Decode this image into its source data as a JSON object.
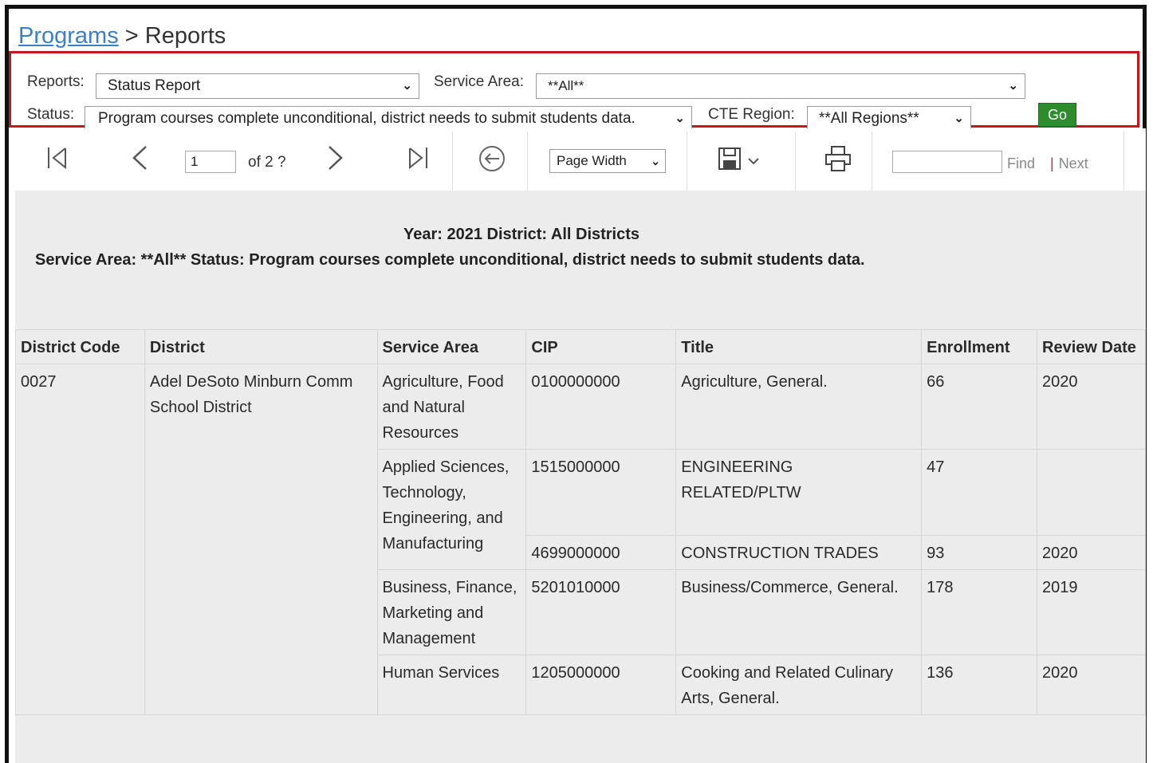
{
  "breadcrumb": {
    "link": "Programs",
    "separator": " > ",
    "current": "Reports"
  },
  "filters": {
    "reports_label": "Reports:",
    "reports_value": "Status Report",
    "service_area_label": "Service Area:",
    "service_area_value": "**All**",
    "status_label": "Status:",
    "status_value": "Program courses complete unconditional, district needs to submit students data.",
    "cte_region_label": "CTE Region:",
    "cte_region_value": "**All Regions**",
    "go_label": "Go"
  },
  "toolbar": {
    "page_value": "1",
    "page_of": "of 2 ?",
    "zoom": "Page Width",
    "find_label": "Find",
    "next_sep": "|",
    "next_label": "Next"
  },
  "report": {
    "header_line1": "Year: 2021 District: All Districts",
    "header_line2": "Service Area: **All** Status: Program courses complete unconditional, district needs to submit students data.",
    "columns": [
      "District Code",
      "District",
      "Service Area",
      "CIP",
      "Title",
      "Enrollment",
      "Review Date"
    ],
    "district_code": "0027",
    "district_name": "Adel DeSoto Minburn Comm School District",
    "rows": [
      {
        "service_area": "Agriculture, Food and Natural Resources",
        "cip": "0100000000",
        "title": "Agriculture, General.",
        "enrollment": "66",
        "review_date": "2020"
      },
      {
        "service_area": "Applied Sciences, Technology, Engineering, and Manufacturing",
        "cip": "1515000000",
        "title": "ENGINEERING RELATED/PLTW",
        "enrollment": "47",
        "review_date": ""
      },
      {
        "service_area": "",
        "cip": "4699000000",
        "title": "CONSTRUCTION TRADES",
        "enrollment": "93",
        "review_date": "2020"
      },
      {
        "service_area": "Business, Finance, Marketing and Management",
        "cip": "5201010000",
        "title": "Business/Commerce, General.",
        "enrollment": "178",
        "review_date": "2019"
      },
      {
        "service_area": "Human Services",
        "cip": "1205000000",
        "title": "Cooking and Related Culinary Arts, General.",
        "enrollment": "136",
        "review_date": "2020"
      }
    ]
  }
}
